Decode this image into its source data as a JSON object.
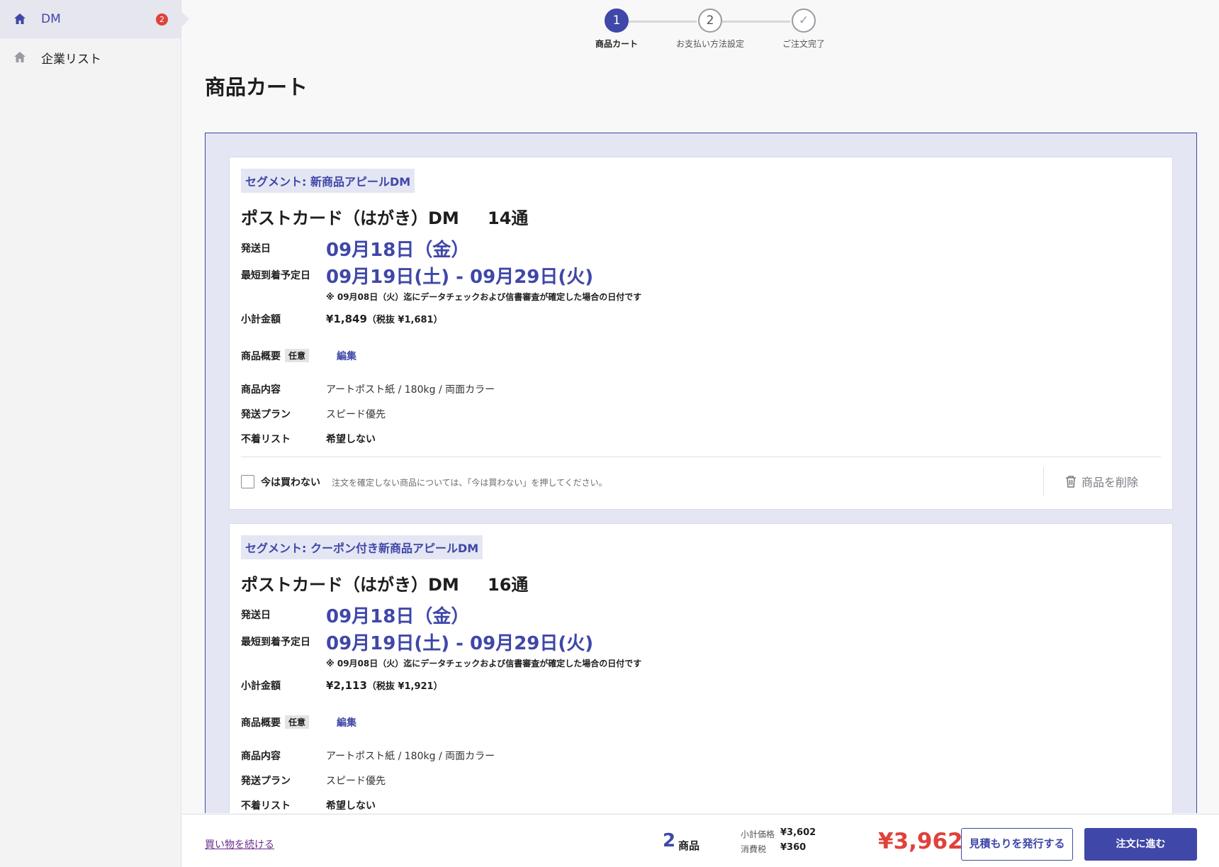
{
  "sidebar": {
    "items": [
      {
        "label": "DM",
        "badge": "2",
        "icon": "home-icon"
      },
      {
        "label": "企業リスト",
        "icon": "home-icon"
      }
    ]
  },
  "stepper": {
    "steps": [
      {
        "number": "1",
        "label": "商品カート"
      },
      {
        "number": "2",
        "label": "お支払い方法設定"
      },
      {
        "number": "✓",
        "label": "ご注文完了"
      }
    ]
  },
  "page_title": "商品カート",
  "labels": {
    "ship_date": "発送日",
    "earliest_arrival": "最短到着予定日",
    "subtotal": "小計金額",
    "summary": "商品概要",
    "optional": "任意",
    "edit": "編集",
    "content": "商品内容",
    "plan": "発送プラン",
    "undeliverable": "不着リスト",
    "not_now": "今は買わない",
    "not_now_hint": "注文を確定しない商品については、「今は買わない」を押してください。",
    "delete": "商品を削除"
  },
  "cart": [
    {
      "segment": "セグメント: 新商品アピールDM",
      "title": "ポストカード（はがき）DM",
      "quantity": "14通",
      "ship_date": "09月18日（金）",
      "arrival": "09月19日(土) - 09月29日(火)",
      "note": "※ 09月08日（火）迄にデータチェックおよび信書審査が確定した場合の日付です",
      "subtotal": "¥1,849",
      "subtotal_tax": "（税抜 ¥1,681）",
      "content": "アートポスト紙 / 180kg / 両面カラー",
      "plan": "スピード優先",
      "undeliverable": "希望しない"
    },
    {
      "segment": "セグメント: クーポン付き新商品アピールDM",
      "title": "ポストカード（はがき）DM",
      "quantity": "16通",
      "ship_date": "09月18日（金）",
      "arrival": "09月19日(土) - 09月29日(火)",
      "note": "※ 09月08日（火）迄にデータチェックおよび信書審査が確定した場合の日付です",
      "subtotal": "¥2,113",
      "subtotal_tax": "（税抜 ¥1,921）",
      "content": "アートポスト紙 / 180kg / 両面カラー",
      "plan": "スピード優先",
      "undeliverable": "希望しない"
    }
  ],
  "footer": {
    "continue": "買い物を続ける",
    "count": "2",
    "count_label": "商品",
    "subtotal_label": "小計価格",
    "subtotal_value": "¥3,602",
    "tax_label": "消費税",
    "tax_value": "¥360",
    "total": "¥3,962",
    "quote_button": "見積もりを発行する",
    "order_button": "注文に進む"
  },
  "colors": {
    "accent": "#3f47a8",
    "total_red": "#e0413b",
    "badge_red": "#e0413b"
  }
}
